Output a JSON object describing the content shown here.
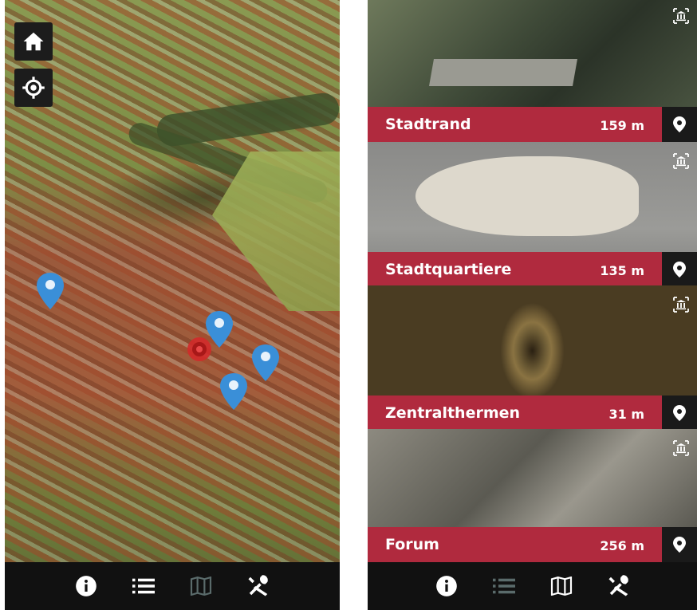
{
  "map_screen": {
    "nav": [
      {
        "name": "info-icon",
        "active": true
      },
      {
        "name": "list-icon",
        "active": true
      },
      {
        "name": "map-icon",
        "active": false
      },
      {
        "name": "tools-icon",
        "active": true
      }
    ]
  },
  "list_screen": {
    "items": [
      {
        "title": "Stadtrand",
        "distance": "159 m"
      },
      {
        "title": "Stadtquartiere",
        "distance": "135 m"
      },
      {
        "title": "Zentralthermen",
        "distance": "31 m"
      },
      {
        "title": "Forum",
        "distance": "256 m"
      }
    ],
    "nav": [
      {
        "name": "info-icon",
        "active": true
      },
      {
        "name": "list-icon",
        "active": false
      },
      {
        "name": "map-icon",
        "active": true
      },
      {
        "name": "tools-icon",
        "active": true
      }
    ]
  },
  "colors": {
    "accent": "#b02a3e",
    "pin_blue": "#3a8fd8",
    "pin_red": "#d22a2a",
    "navbar": "#111111"
  }
}
